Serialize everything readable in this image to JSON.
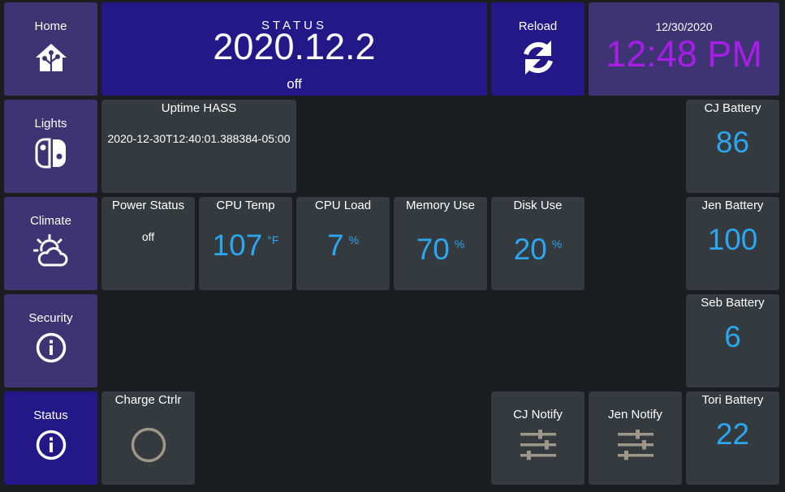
{
  "nav": {
    "home": {
      "label": "Home",
      "icon": "home-assistant-icon"
    },
    "lights": {
      "label": "Lights",
      "icon": "nintendo-switch-icon"
    },
    "climate": {
      "label": "Climate",
      "icon": "weather-partly-cloudy-icon"
    },
    "security": {
      "label": "Security",
      "icon": "info-icon"
    },
    "status": {
      "label": "Status",
      "icon": "info-icon"
    }
  },
  "status_panel": {
    "heading": "STATUS",
    "version": "2020.12.2",
    "state": "off"
  },
  "reload": {
    "label": "Reload",
    "icon": "refresh-icon"
  },
  "clock": {
    "date": "12/30/2020",
    "time": "12:48 PM",
    "time_color": "#a81de8"
  },
  "uptime": {
    "label": "Uptime HASS",
    "value": "2020-12-30T12:40:01.388384-05:00"
  },
  "sensors": {
    "power_status": {
      "label": "Power Status",
      "value": "off"
    },
    "cpu_temp": {
      "label": "CPU Temp",
      "value": "107",
      "unit": "°F"
    },
    "cpu_load": {
      "label": "CPU Load",
      "value": "7",
      "unit": "%"
    },
    "memory_use": {
      "label": "Memory Use",
      "value": "70",
      "unit": "%"
    },
    "disk_use": {
      "label": "Disk Use",
      "value": "20",
      "unit": "%"
    }
  },
  "batteries": {
    "cj": {
      "label": "CJ Battery",
      "value": "86"
    },
    "jen": {
      "label": "Jen Battery",
      "value": "100"
    },
    "seb": {
      "label": "Seb Battery",
      "value": "6"
    },
    "tori": {
      "label": "Tori Battery",
      "value": "22"
    }
  },
  "charge_ctrl": {
    "label": "Charge Ctrlr",
    "icon": "circle-outline-icon"
  },
  "notify": {
    "cj": {
      "label": "CJ Notify",
      "icon": "tune-sliders-icon"
    },
    "jen": {
      "label": "Jen Notify",
      "icon": "tune-sliders-icon"
    }
  },
  "colors": {
    "nav_bg": "#3e3473",
    "nav_active_bg": "#241888",
    "tile_bg": "#353a3e",
    "page_bg": "#1c1d20",
    "value_blue": "#2aa7f0"
  }
}
